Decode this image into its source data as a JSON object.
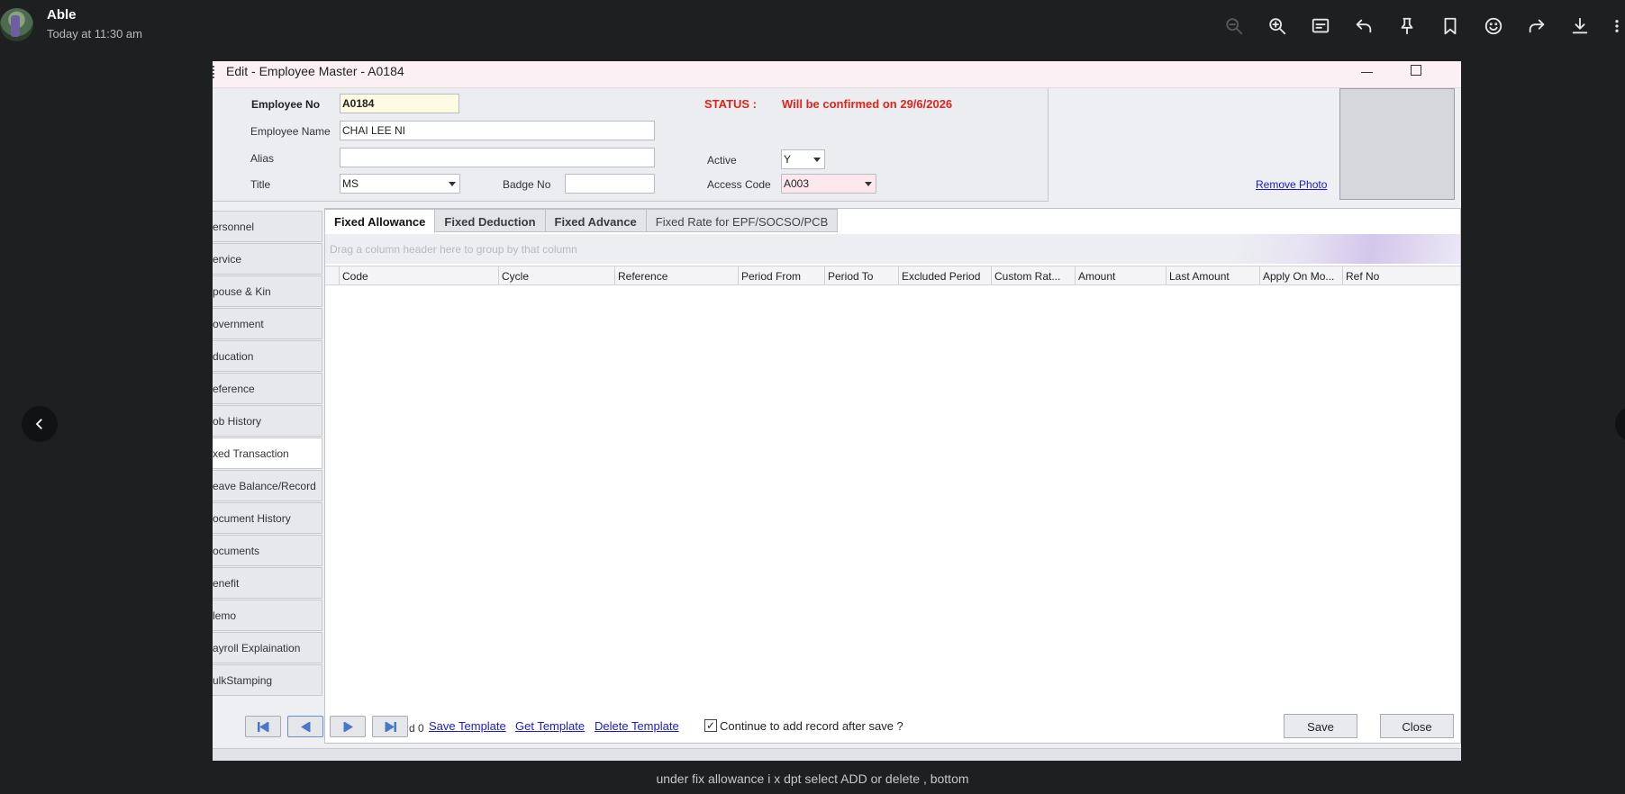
{
  "viewer": {
    "sender_name": "Able",
    "timestamp": "Today at 11:30 am",
    "toolbar_icons": [
      "zoom-out-icon",
      "zoom-in-icon",
      "caption-icon",
      "reply-icon",
      "pin-icon",
      "bookmark-icon",
      "emoji-icon",
      "forward-icon",
      "download-icon",
      "more-icon"
    ],
    "caption": "under fix allowance i x dpt select ADD or delete , bottom"
  },
  "window": {
    "title": "Edit - Employee Master - A0184"
  },
  "form": {
    "employee_no_label": "Employee No",
    "employee_no": "A0184",
    "employee_name_label": "Employee Name",
    "employee_name": "CHAI LEE NI",
    "alias_label": "Alias",
    "alias": "",
    "title_label": "Title",
    "title_value": "MS",
    "badge_label": "Badge No",
    "badge_value": "",
    "status_label": "STATUS :",
    "status_value": "Will be confirmed on 29/6/2026",
    "active_label": "Active",
    "active_value": "Y",
    "access_code_label": "Access Code",
    "access_code_value": "A003",
    "remove_photo": "Remove Photo"
  },
  "menu": [
    {
      "label": "ersonnel"
    },
    {
      "label": "ervice"
    },
    {
      "label": "pouse & Kin"
    },
    {
      "label": "overnment"
    },
    {
      "label": "ducation"
    },
    {
      "label": "eference"
    },
    {
      "label": "ob History"
    },
    {
      "label": "xed Transaction"
    },
    {
      "label": "eave Balance/Record"
    },
    {
      "label": "ocument History"
    },
    {
      "label": "ocuments"
    },
    {
      "label": "enefit"
    },
    {
      "label": "lemo"
    },
    {
      "label": "ayroll Explaination"
    },
    {
      "label": "ulkStamping"
    }
  ],
  "tabs": [
    {
      "label": "Fixed Allowance"
    },
    {
      "label": "Fixed Deduction"
    },
    {
      "label": "Fixed Advance"
    },
    {
      "label": "Fixed Rate for EPF/SOCSO/PCB"
    }
  ],
  "grid": {
    "group_hint": "Drag a column header here to group by that column",
    "columns": [
      "Code",
      "Cycle",
      "Reference",
      "Period From",
      "Period To",
      "Excluded Period",
      "Custom Rat...",
      "Amount",
      "Last Amount",
      "Apply On Mo...",
      "Ref No"
    ]
  },
  "footer": {
    "record_info": "d 0",
    "save_template": "Save Template",
    "get_template": "Get Template",
    "delete_template": "Delete Template",
    "continue_label": "Continue to add record after save ?",
    "continue_checked": true,
    "save_button": "Save",
    "close_button": "Close"
  }
}
